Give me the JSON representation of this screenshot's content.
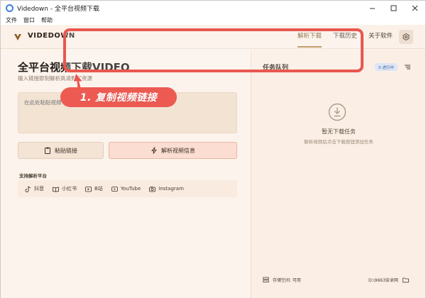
{
  "window": {
    "title": "Videdown - 全平台视频下载"
  },
  "menu": {
    "items": [
      "文件",
      "窗口",
      "帮助"
    ]
  },
  "header": {
    "brand": "VIDEDOWN",
    "tabs": [
      {
        "label": "解析下载",
        "active": true
      },
      {
        "label": "下载历史",
        "active": false
      },
      {
        "label": "关于软件",
        "active": false
      }
    ],
    "settings_icon": "gear-icon"
  },
  "main": {
    "title": "全平台视频下载VIDEO",
    "subtitle": "输入链接即刻解析高清数字资源",
    "input_placeholder": "在此处粘贴视频",
    "paste_button": "粘贴链接",
    "parse_button": "解析视频信息",
    "platforms_title": "支持解析平台",
    "platforms": [
      {
        "name": "抖音",
        "icon": "tiktok-icon"
      },
      {
        "name": "小红书",
        "icon": "book-icon"
      },
      {
        "name": "B站",
        "icon": "tv-icon"
      },
      {
        "name": "YouTube",
        "icon": "play-icon"
      },
      {
        "name": "Instagram",
        "icon": "camera-icon"
      }
    ]
  },
  "queue": {
    "title": "任务队列",
    "badge": "0 进行中",
    "empty_title": "暂无下载任务",
    "empty_hint": "解析视频后点击下载按钮添加任务",
    "storage_label": "存储空间: 可用",
    "path": "D:\\9663安卓网"
  },
  "annotation": {
    "label": "1. 复制视频链接"
  },
  "colors": {
    "accent": "#b7884a",
    "annotation": "#e8574f",
    "background": "#fdf5ee"
  }
}
